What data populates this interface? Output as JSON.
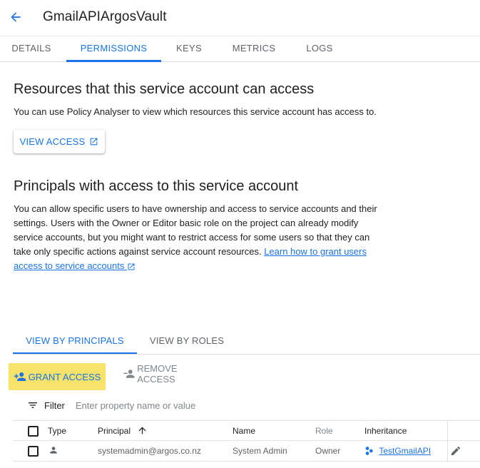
{
  "header": {
    "title": "GmailAPIArgosVault"
  },
  "tabs": [
    {
      "label": "DETAILS"
    },
    {
      "label": "PERMISSIONS"
    },
    {
      "label": "KEYS"
    },
    {
      "label": "METRICS"
    },
    {
      "label": "LOGS"
    }
  ],
  "resources": {
    "heading": "Resources that this service account can access",
    "description": "You can use Policy Analyser to view which resources this service account has access to.",
    "view_access_label": "VIEW ACCESS"
  },
  "principals": {
    "heading": "Principals with access to this service account",
    "description": "You can allow specific users to have ownership and access to service accounts and their settings. Users with the Owner or Editor basic role on the project can already modify service accounts, but you might want to restrict access for some users so that they can take only specific actions against service account resources.",
    "learn_link": "Learn how to grant users access to service accounts"
  },
  "subtabs": [
    {
      "label": "VIEW BY PRINCIPALS"
    },
    {
      "label": "VIEW BY ROLES"
    }
  ],
  "actions": {
    "grant_label": "GRANT ACCESS",
    "remove_label": "REMOVE ACCESS"
  },
  "filter": {
    "label": "Filter",
    "placeholder": "Enter property name or value"
  },
  "table": {
    "columns": [
      "Type",
      "Principal",
      "Name",
      "Role",
      "Inheritance"
    ],
    "rows": [
      {
        "principal": "systemadmin@argos.co.nz",
        "name": "System Admin",
        "role": "Owner",
        "inheritance": "TestGmailAPI"
      }
    ]
  },
  "colors": {
    "accent": "#1a73e8",
    "highlight": "#f7e36a"
  }
}
